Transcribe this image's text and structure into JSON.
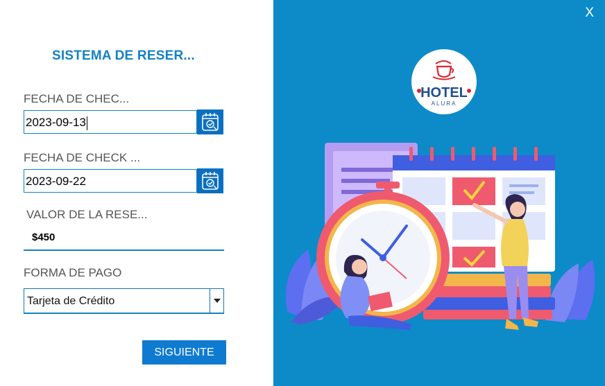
{
  "title": "SISTEMA DE RESER...",
  "checkin": {
    "label": "FECHA DE CHEC...",
    "value": "2023-09-13"
  },
  "checkout": {
    "label": "FECHA DE CHECK ...",
    "value": "2023-09-22"
  },
  "valor": {
    "label": "VALOR DE LA RESE...",
    "value": "$450"
  },
  "pago": {
    "label": "FORMA DE PAGO",
    "selected": "Tarjeta de Crédito"
  },
  "buttons": {
    "next": "SIGUIENTE",
    "close": "X"
  },
  "logo": {
    "line1": "HOTEL",
    "line2": "ALURA"
  },
  "colors": {
    "panel": "#0d8ac8",
    "accent": "#1282c2",
    "button": "#0f7bd0"
  },
  "icons": [
    "calendar-icon",
    "chevron-down-icon",
    "hotel-logo",
    "reservation-illustration"
  ]
}
